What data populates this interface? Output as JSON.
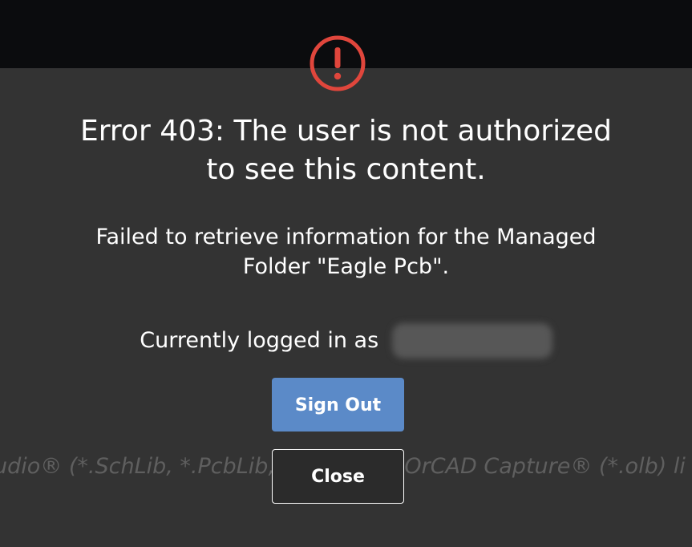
{
  "background": {
    "hint_text": "udio® (*.SchLib, *.PcbLib, *.IntLib) or OrCAD Capture® (*.olb) li"
  },
  "dialog": {
    "icon": "error-exclamation-icon",
    "icon_color": "#e0463c",
    "title_line1": "Error 403: The user is not authorized",
    "title_line2": "to see this content.",
    "message_line1": "Failed to retrieve information for the Managed",
    "message_line2": "Folder \"Eagle Pcb\".",
    "login_prefix": "Currently logged in as",
    "sign_out_label": "Sign Out",
    "close_label": "Close",
    "accent_color": "#5b8ac8"
  }
}
